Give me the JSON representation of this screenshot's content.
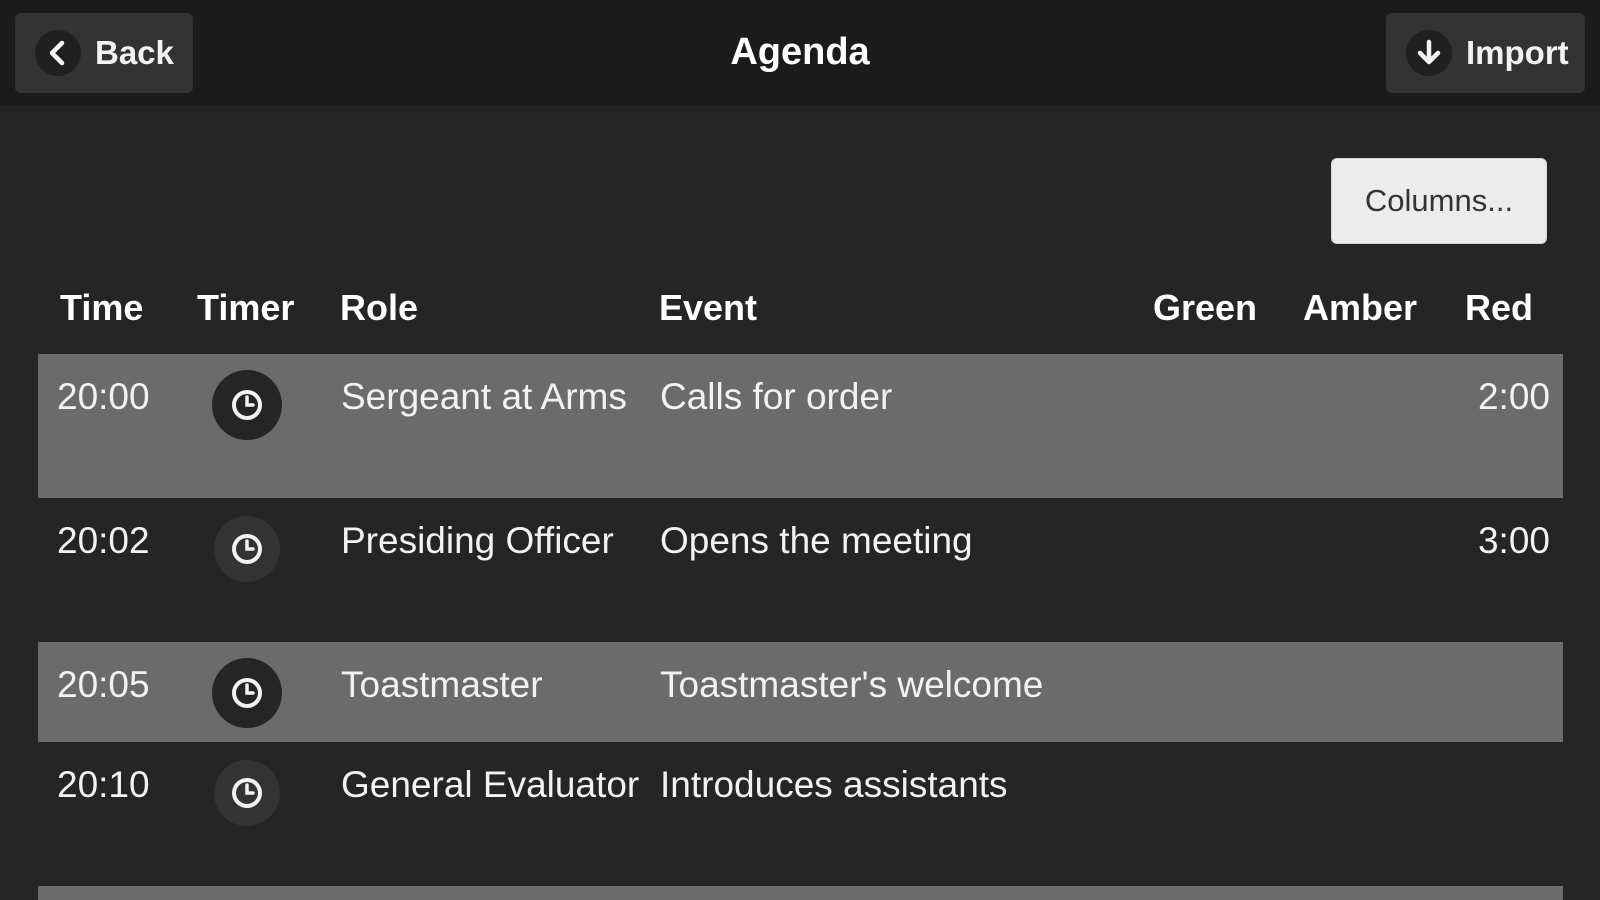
{
  "header": {
    "title": "Agenda",
    "back_label": "Back",
    "import_label": "Import"
  },
  "toolbar": {
    "columns_label": "Columns..."
  },
  "table": {
    "columns": [
      "Time",
      "Timer",
      "Role",
      "Event",
      "Green",
      "Amber",
      "Red"
    ],
    "rows": [
      {
        "time": "20:00",
        "role": "Sergeant at Arms",
        "event": "Calls for order",
        "green": "",
        "amber": "",
        "red": "2:00"
      },
      {
        "time": "20:02",
        "role": "Presiding Officer",
        "event": "Opens the meeting",
        "green": "",
        "amber": "",
        "red": "3:00"
      },
      {
        "time": "20:05",
        "role": "Toastmaster",
        "event": "Toastmaster's welcome",
        "green": "",
        "amber": "",
        "red": ""
      },
      {
        "time": "20:10",
        "role": "General Evaluator",
        "event": "Introduces assistants",
        "green": "",
        "amber": "",
        "red": ""
      }
    ]
  },
  "icons": {
    "back": "chevron-left-icon",
    "import": "arrow-down-icon",
    "timer": "clock-icon"
  },
  "colors": {
    "header_bg": "#1b1b1b",
    "page_bg": "#252525",
    "row_alt_bg": "#6b6b6b",
    "button_light": "#ececec"
  }
}
